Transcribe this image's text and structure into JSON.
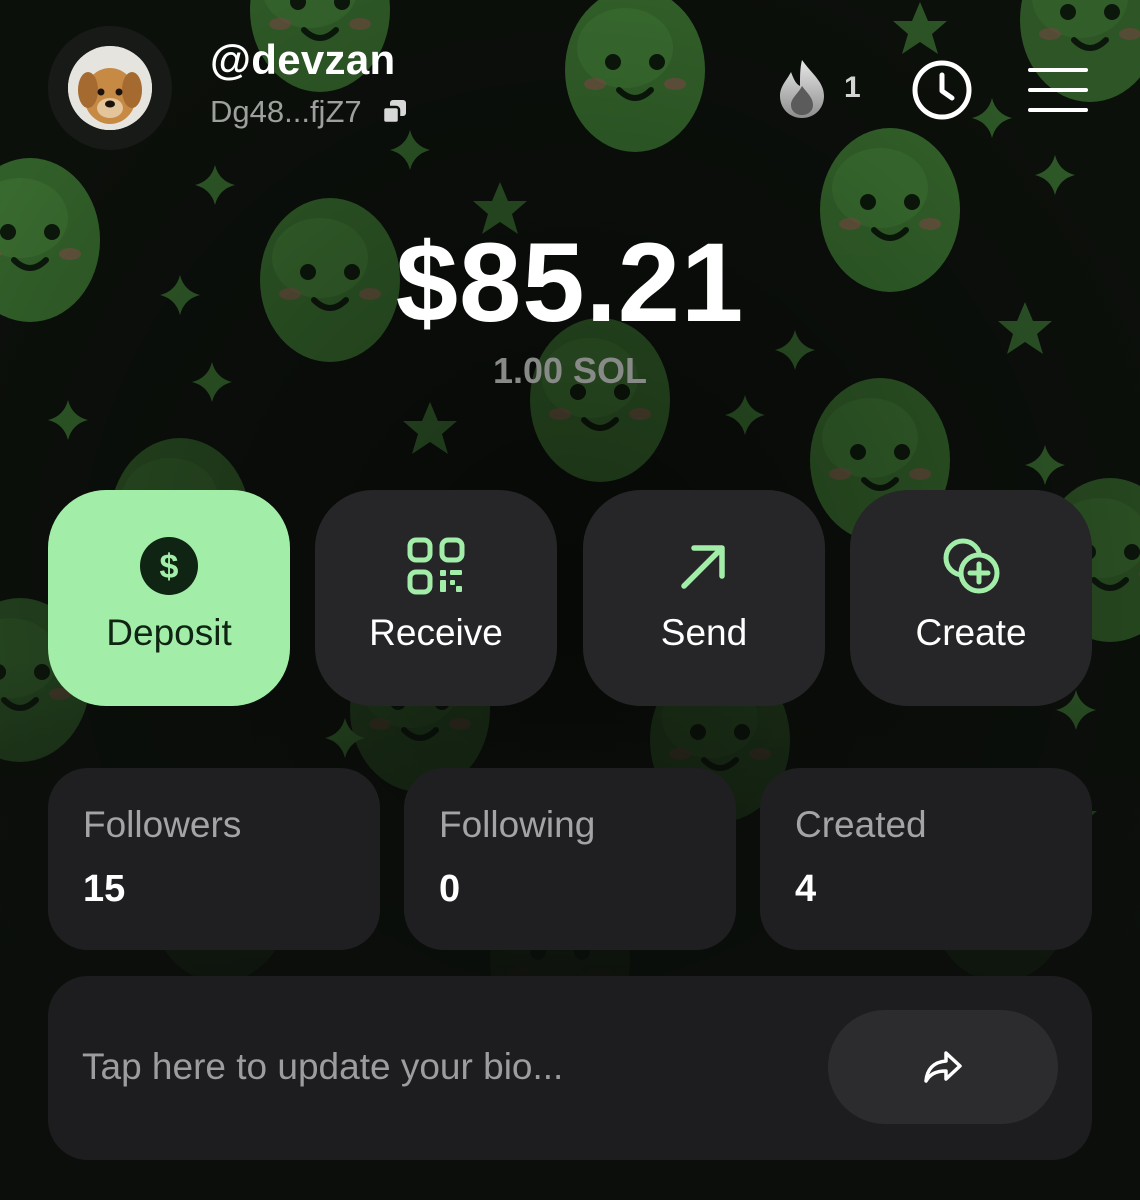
{
  "header": {
    "username": "@devzan",
    "address": "Dg48...fjZ7",
    "streak_count": "1"
  },
  "balance": {
    "usd": "$85.21",
    "sol": "1.00 SOL"
  },
  "actions": [
    {
      "label": "Deposit",
      "icon": "dollar-circle-icon"
    },
    {
      "label": "Receive",
      "icon": "qr-code-icon"
    },
    {
      "label": "Send",
      "icon": "arrow-up-right-icon"
    },
    {
      "label": "Create",
      "icon": "coins-plus-icon"
    }
  ],
  "stats": [
    {
      "label": "Followers",
      "value": "15"
    },
    {
      "label": "Following",
      "value": "0"
    },
    {
      "label": "Created",
      "value": "4"
    }
  ],
  "bio": {
    "placeholder": "Tap here to update your bio..."
  },
  "colors": {
    "background": "#0b0e0b",
    "pattern_green": "#3f7a33",
    "accent": "#a2eea9",
    "card": "#262628"
  },
  "icons": {
    "streak": "flame-icon",
    "history": "clock-icon",
    "menu": "hamburger-menu-icon",
    "copy": "copy-icon",
    "share": "share-arrow-icon"
  }
}
